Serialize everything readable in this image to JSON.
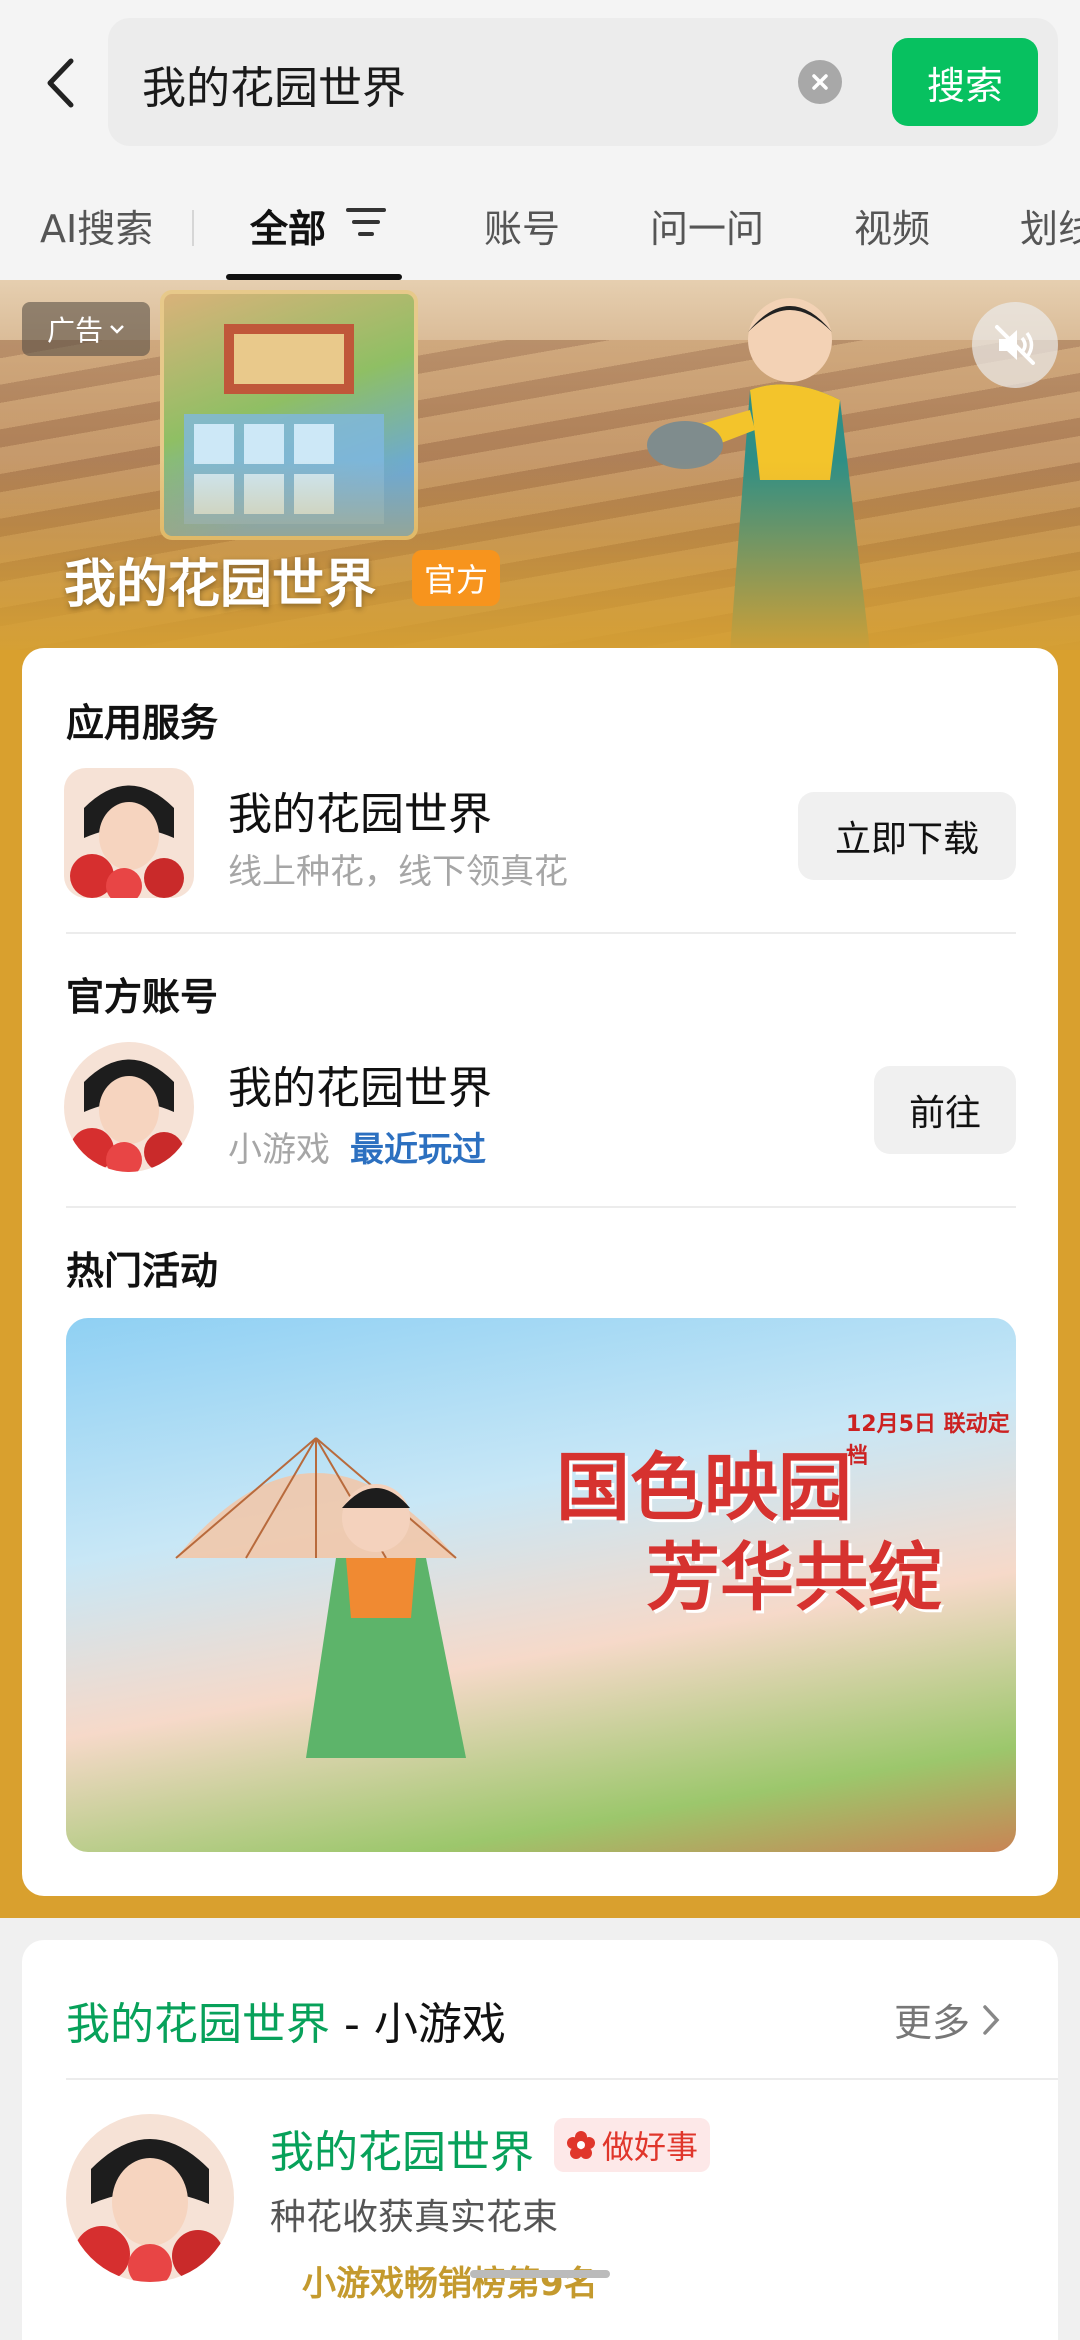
{
  "search": {
    "query": "我的花园世界",
    "button_label": "搜索"
  },
  "tabs": [
    {
      "label": "AI搜索"
    },
    {
      "label": "全部"
    },
    {
      "label": "账号"
    },
    {
      "label": "问一问"
    },
    {
      "label": "视频"
    },
    {
      "label": "划线"
    }
  ],
  "banner": {
    "ad_label": "广告",
    "title": "我的花园世界",
    "official_label": "官方"
  },
  "app_service": {
    "section_title": "应用服务",
    "name": "我的花园世界",
    "subtitle": "线上种花，线下领真花",
    "action_label": "立即下载"
  },
  "official_account": {
    "section_title": "官方账号",
    "name": "我的花园世界",
    "type": "小游戏",
    "recent_tag": "最近玩过",
    "action_label": "前往"
  },
  "hot_activity": {
    "section_title": "热门活动",
    "promo_title_line1": "国色映园",
    "promo_title_line2": "芳华共绽",
    "promo_date": "12月5日 联动定档"
  },
  "mini_game": {
    "title_game": "我的花园世界",
    "title_suffix": " - 小游戏",
    "more_label": "更多",
    "name": "我的花园世界",
    "badge": "做好事",
    "description": "种花收获真实花束",
    "rank": "小游戏畅销榜第9名"
  },
  "colors": {
    "brand_green": "#07c160",
    "banner_gold": "#d9a02e",
    "official_orange": "#f7941d",
    "account_blue": "#2c70c0"
  }
}
